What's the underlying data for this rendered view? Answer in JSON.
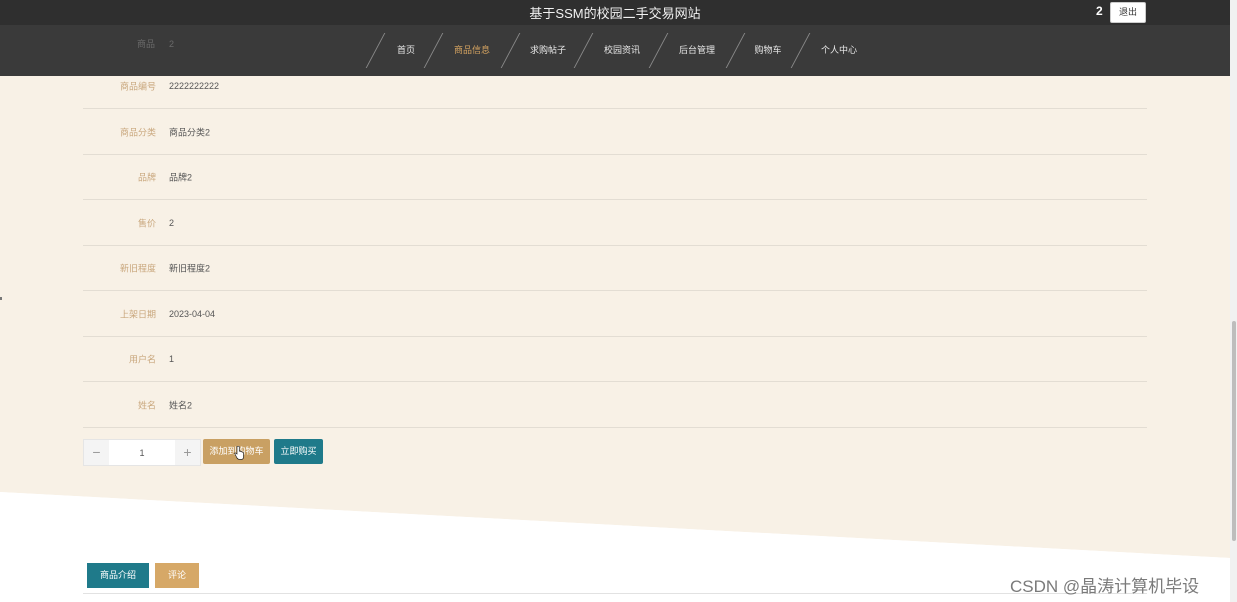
{
  "header": {
    "site_title": "基于SSM的校园二手交易网站",
    "user_count": "2",
    "logout_label": "退出"
  },
  "nav": {
    "ghost_label": "商品",
    "ghost_value": "2",
    "items": [
      {
        "label": "首页",
        "active": false
      },
      {
        "label": "商品信息",
        "active": true
      },
      {
        "label": "求购帖子",
        "active": false
      },
      {
        "label": "校园资讯",
        "active": false
      },
      {
        "label": "后台管理",
        "active": false
      },
      {
        "label": "购物车",
        "active": false
      },
      {
        "label": "个人中心",
        "active": false
      }
    ]
  },
  "details": [
    {
      "label": "商品编号",
      "value": "2222222222"
    },
    {
      "label": "商品分类",
      "value": "商品分类2"
    },
    {
      "label": "品牌",
      "value": "品牌2"
    },
    {
      "label": "售价",
      "value": "2"
    },
    {
      "label": "新旧程度",
      "value": "新旧程度2"
    },
    {
      "label": "上架日期",
      "value": "2023-04-04"
    },
    {
      "label": "用户名",
      "value": "1"
    },
    {
      "label": "姓名",
      "value": "姓名2"
    }
  ],
  "quantity": {
    "minus": "−",
    "plus": "+",
    "value": "1"
  },
  "actions": {
    "add_to_cart": "添加到购物车",
    "buy_now": "立即购买"
  },
  "tabs": {
    "intro": "商品介绍",
    "comments": "评论"
  },
  "watermark": "CSDN @晶涛计算机毕设",
  "colors": {
    "header_bg": "#2f2f2f",
    "nav_active": "#d6a461",
    "accent_teal": "#1f7a8a",
    "accent_gold": "#c9a063",
    "page_bg": "#f8f1e6"
  }
}
